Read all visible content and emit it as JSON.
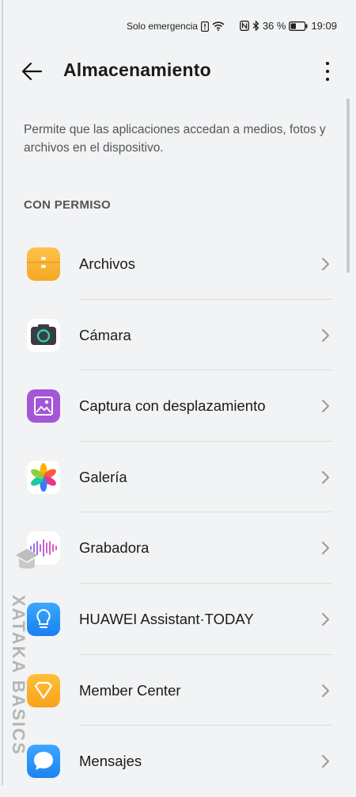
{
  "status_bar": {
    "carrier": "Solo emergencia",
    "battery": "36 %",
    "time": "19:09"
  },
  "header": {
    "title": "Almacenamiento"
  },
  "description": "Permite que las aplicaciones accedan a medios, fotos y archivos en el dispositivo.",
  "section_header": "CON PERMISO",
  "apps": [
    {
      "label": "Archivos",
      "icon": "files-icon"
    },
    {
      "label": "Cámara",
      "icon": "camera-icon"
    },
    {
      "label": "Captura con desplazamiento",
      "icon": "scrollshot-icon"
    },
    {
      "label": "Galería",
      "icon": "gallery-icon"
    },
    {
      "label": "Grabadora",
      "icon": "recorder-icon"
    },
    {
      "label": "HUAWEI Assistant·TODAY",
      "icon": "assistant-icon"
    },
    {
      "label": "Member Center",
      "icon": "member-center-icon"
    },
    {
      "label": "Mensajes",
      "icon": "messages-icon"
    }
  ],
  "watermark": "XATAKA BASICS"
}
